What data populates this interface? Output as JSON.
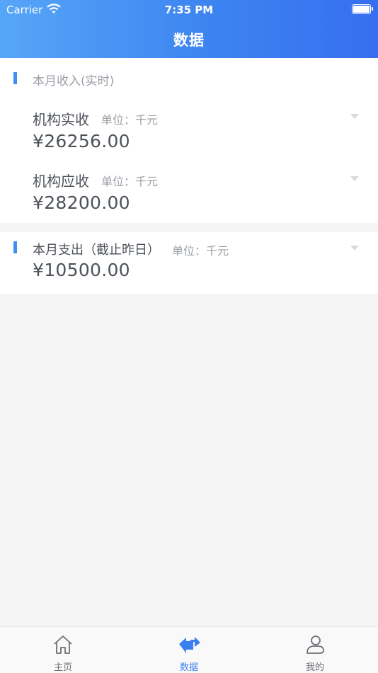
{
  "status_bar": {
    "carrier": "Carrier",
    "time": "7:35 PM"
  },
  "nav": {
    "title": "数据"
  },
  "income": {
    "section_title": "本月收入(实时)",
    "rows": [
      {
        "label": "机构实收",
        "unit": "单位：千元",
        "value": "¥26256.00"
      },
      {
        "label": "机构应收",
        "unit": "单位：千元",
        "value": "¥28200.00"
      }
    ]
  },
  "expense": {
    "title": "本月支出（截止昨日）",
    "unit": "单位：千元",
    "value": "¥10500.00"
  },
  "tabbar": {
    "items": [
      {
        "label": "主页",
        "icon": "home-icon",
        "active": false
      },
      {
        "label": "数据",
        "icon": "data-icon",
        "active": true
      },
      {
        "label": "我的",
        "icon": "profile-icon",
        "active": false
      }
    ]
  },
  "colors": {
    "accent": "#3a7ff0",
    "header_start": "#56a6f8",
    "header_end": "#376ef0"
  }
}
